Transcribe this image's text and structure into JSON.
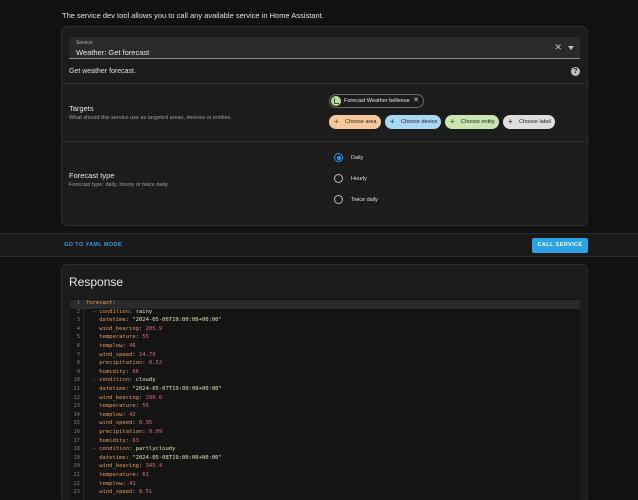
{
  "intro_text": "The service dev tool allows you to call any available service in Home Assistant.",
  "service": {
    "label": "Service",
    "value": "Weather: Get forecast",
    "description": "Get weather forecast.",
    "help_glyph": "?"
  },
  "targets": {
    "title": "Targets",
    "description": "What should this service use as targeted areas, devices or entities.",
    "selected_entity": "Forecast Weather bellevue",
    "chips": [
      {
        "label": "Choose area",
        "bg": "#f7c89b",
        "fg": "#b25e12"
      },
      {
        "label": "Choose device",
        "bg": "#a9d8f5",
        "fg": "#1a6fa8"
      },
      {
        "label": "Choose entity",
        "bg": "#c9e6b2",
        "fg": "#4b8a2a"
      },
      {
        "label": "Choose label",
        "bg": "#dedede",
        "fg": "#555555"
      }
    ]
  },
  "forecast_type": {
    "title": "Forecast type",
    "description": "Forecast type: daily, hourly or twice daily.",
    "options": [
      {
        "label": "Daily",
        "selected": true
      },
      {
        "label": "Hourly",
        "selected": false
      },
      {
        "label": "Twice daily",
        "selected": false
      }
    ]
  },
  "actions": {
    "yaml_label": "GO TO YAML MODE",
    "call_label": "CALL SERVICE"
  },
  "response": {
    "title": "Response",
    "lines": [
      {
        "n": "1",
        "parts": [
          [
            "k",
            "forecast"
          ],
          [
            "p",
            ":"
          ]
        ]
      },
      {
        "n": "2",
        "parts": [
          [
            "p",
            "  - "
          ],
          [
            "k",
            "condition"
          ],
          [
            "p",
            ": "
          ],
          [
            "s",
            "rainy"
          ]
        ]
      },
      {
        "n": "3",
        "parts": [
          [
            "p",
            "    "
          ],
          [
            "k",
            "datetime"
          ],
          [
            "p",
            ": "
          ],
          [
            "s",
            "\"2024-05-06T19:00:00+00:00\""
          ]
        ]
      },
      {
        "n": "4",
        "parts": [
          [
            "p",
            "    "
          ],
          [
            "k",
            "wind_bearing"
          ],
          [
            "p",
            ": "
          ],
          [
            "n",
            "205.9"
          ]
        ]
      },
      {
        "n": "5",
        "parts": [
          [
            "p",
            "    "
          ],
          [
            "k",
            "temperature"
          ],
          [
            "p",
            ": "
          ],
          [
            "n",
            "55"
          ]
        ]
      },
      {
        "n": "6",
        "parts": [
          [
            "p",
            "    "
          ],
          [
            "k",
            "templow"
          ],
          [
            "p",
            ": "
          ],
          [
            "n",
            "46"
          ]
        ]
      },
      {
        "n": "7",
        "parts": [
          [
            "p",
            "    "
          ],
          [
            "k",
            "wind_speed"
          ],
          [
            "p",
            ": "
          ],
          [
            "n",
            "14.79"
          ]
        ]
      },
      {
        "n": "8",
        "parts": [
          [
            "p",
            "    "
          ],
          [
            "k",
            "precipitation"
          ],
          [
            "p",
            ": "
          ],
          [
            "n",
            "0.52"
          ]
        ]
      },
      {
        "n": "9",
        "parts": [
          [
            "p",
            "    "
          ],
          [
            "k",
            "humidity"
          ],
          [
            "p",
            ": "
          ],
          [
            "n",
            "66"
          ]
        ]
      },
      {
        "n": "10",
        "parts": [
          [
            "p",
            "  - "
          ],
          [
            "k",
            "condition"
          ],
          [
            "p",
            ": "
          ],
          [
            "s",
            "cloudy"
          ]
        ]
      },
      {
        "n": "11",
        "parts": [
          [
            "p",
            "    "
          ],
          [
            "k",
            "datetime"
          ],
          [
            "p",
            ": "
          ],
          [
            "s",
            "\"2024-05-07T19:00:00+00:00\""
          ]
        ]
      },
      {
        "n": "12",
        "parts": [
          [
            "p",
            "    "
          ],
          [
            "k",
            "wind_bearing"
          ],
          [
            "p",
            ": "
          ],
          [
            "n",
            "290.6"
          ]
        ]
      },
      {
        "n": "13",
        "parts": [
          [
            "p",
            "    "
          ],
          [
            "k",
            "temperature"
          ],
          [
            "p",
            ": "
          ],
          [
            "n",
            "56"
          ]
        ]
      },
      {
        "n": "14",
        "parts": [
          [
            "p",
            "    "
          ],
          [
            "k",
            "templow"
          ],
          [
            "p",
            ": "
          ],
          [
            "n",
            "42"
          ]
        ]
      },
      {
        "n": "15",
        "parts": [
          [
            "p",
            "    "
          ],
          [
            "k",
            "wind_speed"
          ],
          [
            "p",
            ": "
          ],
          [
            "n",
            "8.95"
          ]
        ]
      },
      {
        "n": "16",
        "parts": [
          [
            "p",
            "    "
          ],
          [
            "k",
            "precipitation"
          ],
          [
            "p",
            ": "
          ],
          [
            "n",
            "0.09"
          ]
        ]
      },
      {
        "n": "17",
        "parts": [
          [
            "p",
            "    "
          ],
          [
            "k",
            "humidity"
          ],
          [
            "p",
            ": "
          ],
          [
            "n",
            "63"
          ]
        ]
      },
      {
        "n": "18",
        "parts": [
          [
            "p",
            "  - "
          ],
          [
            "k",
            "condition"
          ],
          [
            "p",
            ": "
          ],
          [
            "s",
            "partlycloudy"
          ]
        ]
      },
      {
        "n": "19",
        "parts": [
          [
            "p",
            "    "
          ],
          [
            "k",
            "datetime"
          ],
          [
            "p",
            ": "
          ],
          [
            "s",
            "\"2024-05-08T19:00:00+00:00\""
          ]
        ]
      },
      {
        "n": "20",
        "parts": [
          [
            "p",
            "    "
          ],
          [
            "k",
            "wind_bearing"
          ],
          [
            "p",
            ": "
          ],
          [
            "n",
            "345.4"
          ]
        ]
      },
      {
        "n": "21",
        "parts": [
          [
            "p",
            "    "
          ],
          [
            "k",
            "temperature"
          ],
          [
            "p",
            ": "
          ],
          [
            "n",
            "61"
          ]
        ]
      },
      {
        "n": "22",
        "parts": [
          [
            "p",
            "    "
          ],
          [
            "k",
            "templow"
          ],
          [
            "p",
            ": "
          ],
          [
            "n",
            "41"
          ]
        ]
      },
      {
        "n": "23",
        "parts": [
          [
            "p",
            "    "
          ],
          [
            "k",
            "wind_speed"
          ],
          [
            "p",
            ": "
          ],
          [
            "n",
            "8.51"
          ]
        ]
      }
    ]
  }
}
